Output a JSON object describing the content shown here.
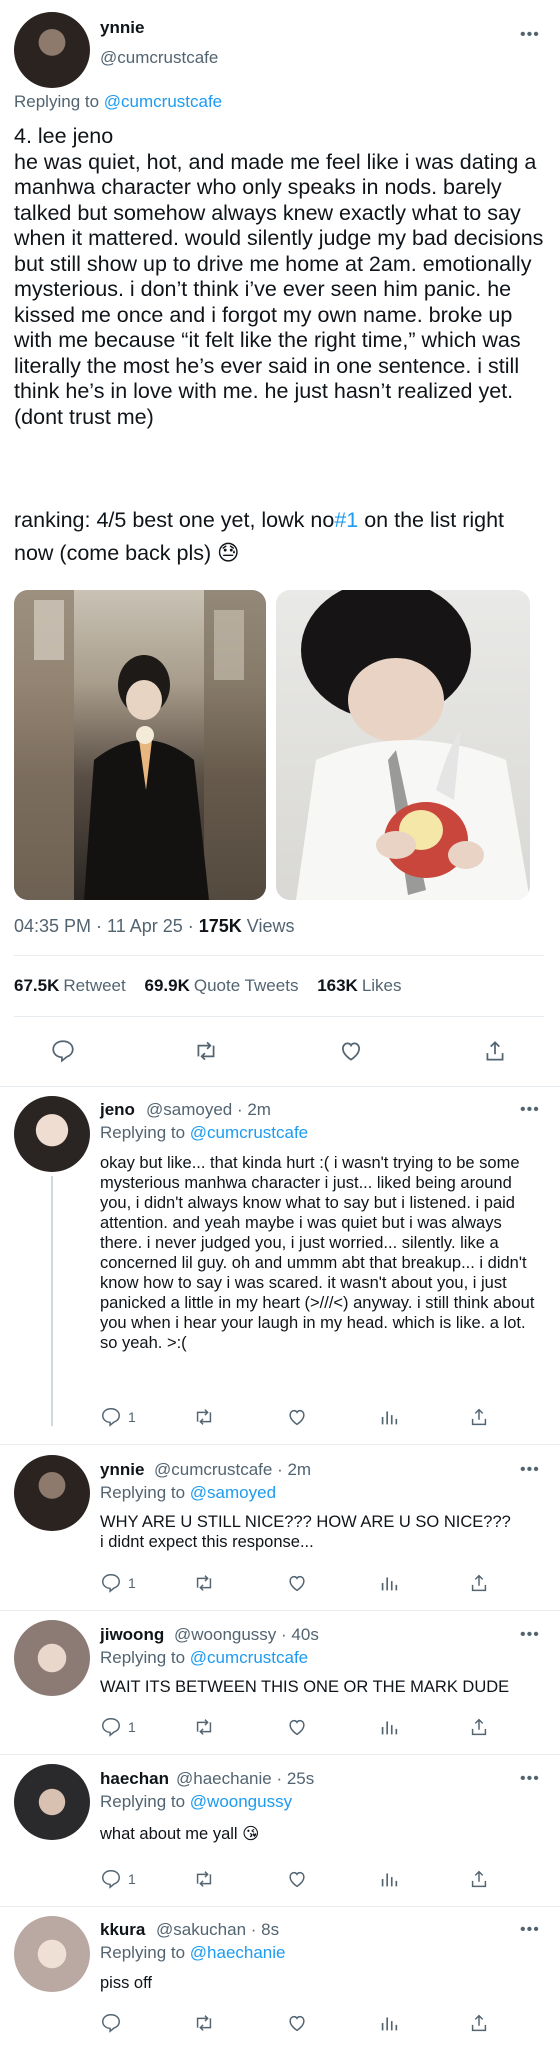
{
  "main_tweet": {
    "display_name": "ynnie",
    "handle": "@cumcrustcafe",
    "replying_label": "Replying to ",
    "replying_to": "@cumcrustcafe",
    "text": "4. lee jeno\nhe was quiet, hot, and made me feel like i was dating a manhwa character who only speaks in nods. barely talked but somehow always knew exactly what to say when it mattered. would silently judge my bad decisions but still show up to drive me home at 2am. emotionally mysterious. i don’t think i’ve ever seen him panic. he kissed me once and i forgot my own name. broke up with me because “it felt like the right time,” which was literally the most he’s ever said in one sentence. i still think he’s in love with me. he just hasn’t realized yet. (dont trust me)",
    "ranking_prefix": "ranking: 4/5 best one yet, lowk no",
    "ranking_hashtag": "#1",
    "ranking_suffix": " on the list right now (come back pls) ",
    "ranking_emoji": "😓",
    "time": "04:35 PM · 11 Apr 25 · ",
    "views_count": "175K",
    "views_label": " Views",
    "retweets_count": "67.5K",
    "retweets_label": "Retweet",
    "quotes_count": "69.9K",
    "quotes_label": "Quote Tweets",
    "likes_count": "163K",
    "likes_label": "Likes"
  },
  "replies": [
    {
      "display_name": "jeno",
      "meta": "@samoyed · 2m",
      "replying_label": "Replying to ",
      "replying_to": "@cumcrustcafe",
      "text": "okay but like... that kinda hurt :( i wasn't trying to be some mysterious manhwa character i just... liked being around you, i didn't always know what to say but i listened. i paid attention. and yeah maybe i was quiet but i was always there. i never judged you, i just worried... silently. like a concerned lil guy. oh and ummm abt that breakup... i didn't know how to say i was scared. it wasn't about you, i just panicked a little in my heart (>///<) anyway. i still think about you when i hear your laugh in my head. which is like. a lot. so yeah. >:(",
      "reply_count": "1"
    },
    {
      "display_name": "ynnie",
      "meta": "@cumcrustcafe · 2m",
      "replying_label": "Replying to ",
      "replying_to": "@samoyed",
      "text": "WHY ARE U STILL NICE??? HOW ARE U SO NICE???\ni didnt expect this response...",
      "reply_count": "1"
    },
    {
      "display_name": "jiwoong",
      "meta": "@woongussy · 40s",
      "replying_label": "Replying to ",
      "replying_to": "@cumcrustcafe",
      "text": "WAIT ITS BETWEEN THIS ONE OR THE MARK DUDE",
      "reply_count": "1"
    },
    {
      "display_name": "haechan",
      "meta": "@haechanie · 25s",
      "replying_label": "Replying to ",
      "replying_to": "@woongussy",
      "text": "what about me yall 😘",
      "reply_count": "1"
    },
    {
      "display_name": "kkura",
      "meta": "@sakuchan · 8s",
      "replying_label": "Replying to ",
      "replying_to": "@haechanie",
      "text": "piss off",
      "reply_count": ""
    }
  ],
  "more_glyph": "•••",
  "colors": {
    "link": "#1d9bf0",
    "secondary": "#536471",
    "divider": "#e6ecf0"
  },
  "icons": [
    "reply-icon",
    "retweet-icon",
    "like-icon",
    "share-icon",
    "analytics-icon",
    "more-icon"
  ]
}
